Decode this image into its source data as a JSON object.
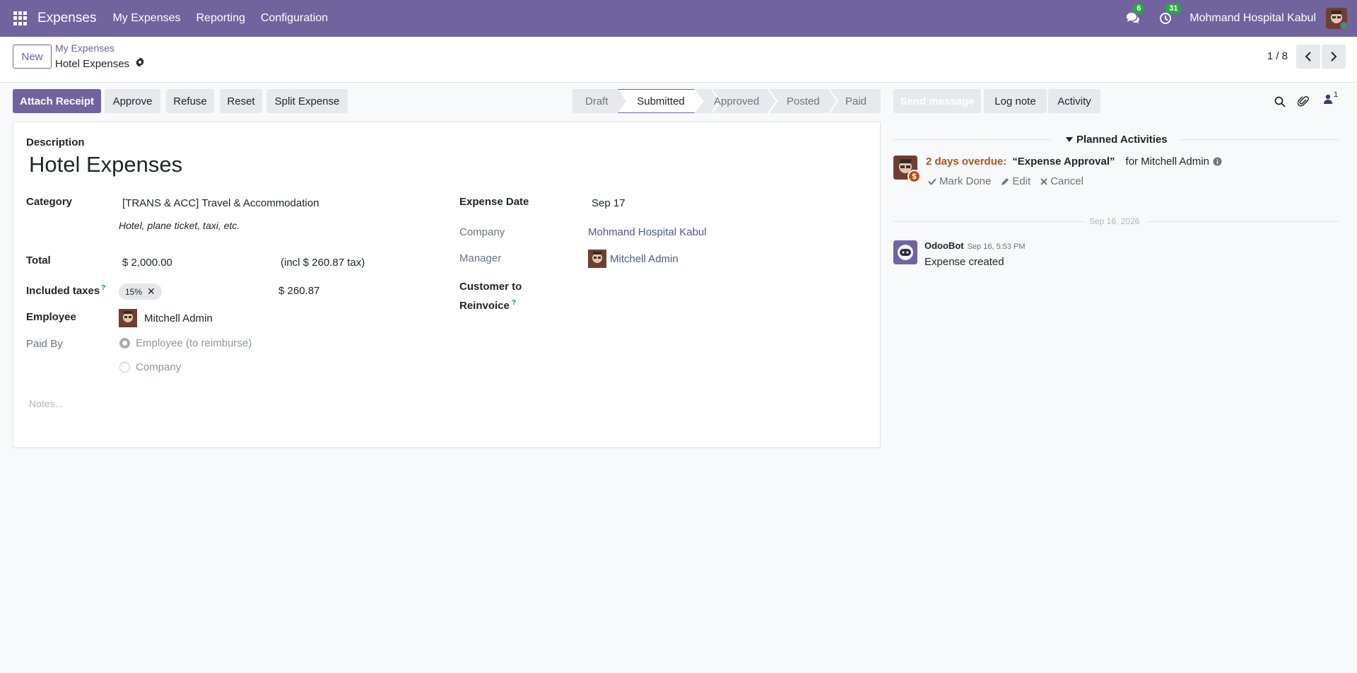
{
  "navbar": {
    "app_name": "Expenses",
    "menu": [
      "My Expenses",
      "Reporting",
      "Configuration"
    ],
    "messages_count": "6",
    "activities_count": "31",
    "company": "Mohmand Hospital Kabul"
  },
  "control": {
    "new_label": "New",
    "breadcrumb_parent": "My Expenses",
    "breadcrumb_current": "Hotel Expenses",
    "pager": "1 / 8"
  },
  "actions": {
    "attach_receipt": "Attach Receipt",
    "approve": "Approve",
    "refuse": "Refuse",
    "reset": "Reset",
    "split_expense": "Split Expense"
  },
  "status": {
    "stages": [
      "Draft",
      "Submitted",
      "Approved",
      "Posted",
      "Paid"
    ],
    "current": "Submitted"
  },
  "form": {
    "description_label": "Description",
    "description": "Hotel Expenses",
    "category_label": "Category",
    "category": "[TRANS & ACC] Travel & Accommodation",
    "category_hint": "Hotel, plane ticket, taxi, etc.",
    "total_label": "Total",
    "total": "$ 2,000.00",
    "total_tax_note": "(incl $ 260.87 tax)",
    "taxes_label": "Included taxes",
    "tax_tag": "15%",
    "tax_amount": "$ 260.87",
    "employee_label": "Employee",
    "employee": "Mitchell Admin",
    "paid_by_label": "Paid By",
    "paid_by_options": [
      "Employee (to reimburse)",
      "Company"
    ],
    "expense_date_label": "Expense Date",
    "expense_date": "Sep 17",
    "company_label": "Company",
    "company": "Mohmand Hospital Kabul",
    "manager_label": "Manager",
    "manager": "Mitchell Admin",
    "reinvoice_label_1": "Customer to",
    "reinvoice_label_2": "Reinvoice",
    "notes_placeholder": "Notes..."
  },
  "chatter": {
    "send_message": "Send message",
    "log_note": "Log note",
    "activity": "Activity",
    "followers_count": "1",
    "planned_title": "Planned Activities",
    "overdue": "2 days overdue:",
    "activity_name": "“Expense Approval”",
    "activity_for": "for Mitchell Admin",
    "mark_done": "Mark Done",
    "edit": "Edit",
    "cancel": "Cancel",
    "date_separator": "Sep 16, 2026",
    "msg_author": "OdooBot",
    "msg_time": "Sep 16, 5:53 PM",
    "msg_body": "Expense created"
  },
  "colors": {
    "brand": "#71639e",
    "overdue": "#b5501a",
    "success": "#28a745"
  }
}
